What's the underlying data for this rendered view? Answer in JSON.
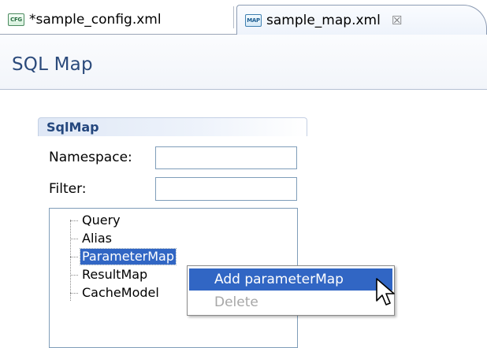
{
  "tabs": [
    {
      "icon": "config-file-icon",
      "icon_text": "CFG",
      "label": "*sample_config.xml",
      "active": false
    },
    {
      "icon": "map-file-icon",
      "icon_text": "MAP",
      "label": "sample_map.xml",
      "close": "☒",
      "active": true
    }
  ],
  "header": {
    "title": "SQL Map"
  },
  "section": {
    "title": "SqlMap",
    "namespace_label": "Namespace:",
    "namespace_value": "",
    "filter_label": "Filter:",
    "filter_value": ""
  },
  "tree": {
    "items": [
      {
        "label": "Query",
        "selected": false
      },
      {
        "label": "Alias",
        "selected": false
      },
      {
        "label": "ParameterMap",
        "selected": true
      },
      {
        "label": "ResultMap",
        "selected": false
      },
      {
        "label": "CacheModel",
        "selected": false
      }
    ]
  },
  "context_menu": {
    "items": [
      {
        "label": "Add parameterMap",
        "enabled": true,
        "highlighted": true
      },
      {
        "label": "Delete",
        "enabled": false,
        "highlighted": false
      }
    ]
  },
  "colors": {
    "selection": "#3166c4",
    "title": "#2b4a7b",
    "section_title": "#24477e"
  }
}
